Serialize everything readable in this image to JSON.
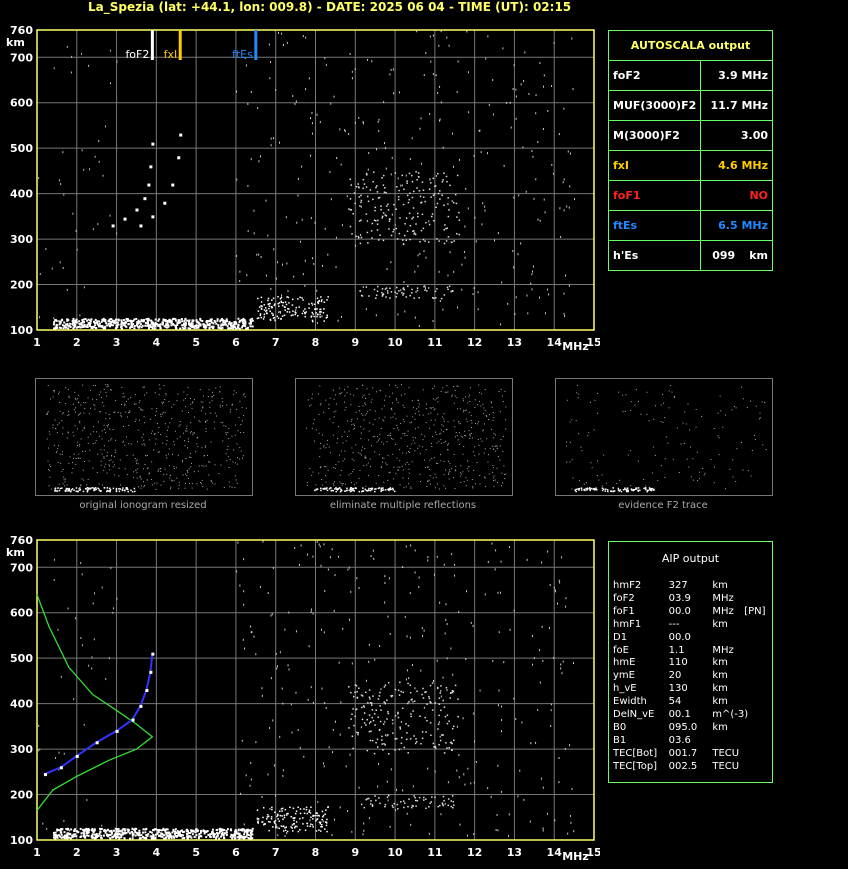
{
  "title": "La_Spezia (lat: +44.1, lon: 009.8) - DATE: 2025 06 04 - TIME (UT): 02:15",
  "colors": {
    "grid": "#777777",
    "axis": "#ffff66",
    "white": "#ffffff",
    "yellow": "#ffcc00",
    "blue": "#2288ff",
    "red": "#ff2222",
    "green": "#33dd33",
    "trace": "#3333ff"
  },
  "chart_data": [
    {
      "type": "scatter",
      "name": "ionogram-top",
      "xlabel": "MHz",
      "ylabel": "km",
      "xlim": [
        1,
        15
      ],
      "ylim": [
        100,
        760
      ],
      "x_ticks": [
        "1",
        "2",
        "3",
        "4",
        "5",
        "6",
        "7",
        "8",
        "9",
        "10",
        "11",
        "12",
        "13",
        "14",
        "15"
      ],
      "y_ticks": [
        "100",
        "200",
        "300",
        "400",
        "500",
        "600",
        "700",
        "760"
      ],
      "markers": [
        {
          "label": "foF2",
          "x": 3.9,
          "color": "white"
        },
        {
          "label": "fxI",
          "x": 4.6,
          "color": "yellow"
        },
        {
          "label": "ftEs",
          "x": 6.5,
          "color": "blue"
        }
      ],
      "o_trace": [
        [
          2.9,
          330
        ],
        [
          3.2,
          345
        ],
        [
          3.5,
          365
        ],
        [
          3.7,
          390
        ],
        [
          3.8,
          420
        ],
        [
          3.85,
          460
        ],
        [
          3.9,
          510
        ]
      ],
      "x_trace": [
        [
          3.6,
          330
        ],
        [
          3.9,
          350
        ],
        [
          4.2,
          380
        ],
        [
          4.4,
          420
        ],
        [
          4.55,
          480
        ],
        [
          4.6,
          530
        ]
      ]
    },
    {
      "type": "scatter",
      "name": "ionogram-bottom",
      "xlabel": "MHz",
      "ylabel": "km",
      "xlim": [
        1,
        15
      ],
      "ylim": [
        100,
        760
      ],
      "x_ticks": [
        "1",
        "2",
        "3",
        "4",
        "5",
        "6",
        "7",
        "8",
        "9",
        "10",
        "11",
        "12",
        "13",
        "14",
        "15"
      ],
      "y_ticks": [
        "100",
        "200",
        "300",
        "400",
        "500",
        "600",
        "700",
        "760"
      ],
      "profile": [
        [
          1.0,
          640
        ],
        [
          1.3,
          570
        ],
        [
          1.8,
          480
        ],
        [
          2.4,
          420
        ],
        [
          3.0,
          385
        ],
        [
          3.5,
          355
        ],
        [
          3.9,
          327
        ],
        [
          3.5,
          300
        ],
        [
          2.8,
          275
        ],
        [
          2.0,
          240
        ],
        [
          1.4,
          210
        ],
        [
          1.0,
          165
        ]
      ],
      "trace": [
        [
          1.2,
          245
        ],
        [
          1.6,
          260
        ],
        [
          2.0,
          285
        ],
        [
          2.5,
          315
        ],
        [
          3.0,
          340
        ],
        [
          3.4,
          365
        ],
        [
          3.6,
          395
        ],
        [
          3.75,
          430
        ],
        [
          3.85,
          470
        ],
        [
          3.9,
          510
        ]
      ]
    }
  ],
  "autoscala": {
    "header": "AUTOSCALA output",
    "rows": [
      {
        "label": "foF2",
        "value": "3.9 MHz",
        "color": "#ffffff"
      },
      {
        "label": "MUF(3000)F2",
        "value": "11.7 MHz",
        "color": "#ffffff"
      },
      {
        "label": "M(3000)F2",
        "value": "3.00",
        "color": "#ffffff"
      },
      {
        "label": "fxI",
        "value": "4.6 MHz",
        "color": "#ffcc00"
      },
      {
        "label": "foF1",
        "value": "NO",
        "color": "#ff2222"
      },
      {
        "label": "ftEs",
        "value": "6.5 MHz",
        "color": "#2288ff"
      },
      {
        "label": "h'Es",
        "value": "099",
        "unit": "km",
        "color": "#ffffff"
      }
    ]
  },
  "aip": {
    "header": "AIP output",
    "rows": [
      [
        "hmF2",
        "327",
        "km",
        ""
      ],
      [
        "foF2",
        "03.9",
        "MHz",
        ""
      ],
      [
        "foF1",
        "00.0",
        "MHz",
        "[PN]"
      ],
      [
        "hmF1",
        "---",
        "km",
        ""
      ],
      [
        "D1",
        "00.0",
        "",
        ""
      ],
      [
        "foE",
        "1.1",
        "MHz",
        ""
      ],
      [
        "hmE",
        "110",
        "km",
        ""
      ],
      [
        "ymE",
        "20",
        "km",
        ""
      ],
      [
        "h_vE",
        "130",
        "km",
        ""
      ],
      [
        "Ewidth",
        "54",
        "km",
        ""
      ],
      [
        "DelN_vE",
        "00.1",
        "m^(-3)",
        ""
      ],
      [
        "B0",
        "095.0",
        "km",
        ""
      ],
      [
        "B1",
        "03.6",
        "",
        ""
      ],
      [
        "TEC[Bot]",
        "001.7",
        "TECU",
        ""
      ],
      [
        "TEC[Top]",
        "002.5",
        "TECU",
        ""
      ]
    ]
  },
  "captions": [
    "original ionogram resized",
    "eliminate multiple reflections",
    "evidence F2 trace"
  ]
}
